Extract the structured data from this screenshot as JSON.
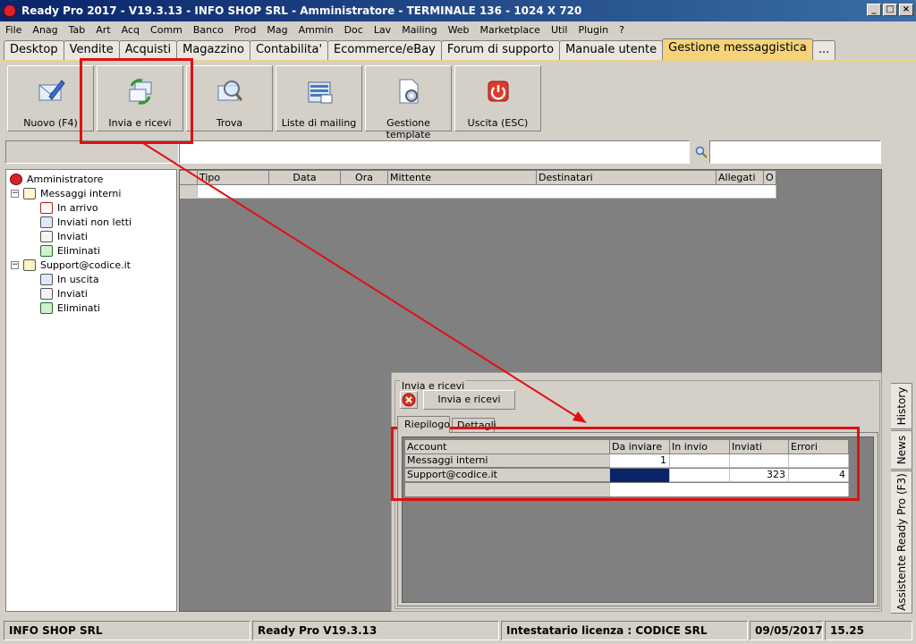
{
  "window": {
    "title": "Ready Pro 2017 - V19.3.13 - INFO SHOP SRL - Amministratore - TERMINALE 136 - 1024 X 720"
  },
  "menu": [
    "File",
    "Anag",
    "Tab",
    "Art",
    "Acq",
    "Comm",
    "Banco",
    "Prod",
    "Mag",
    "Ammin",
    "Doc",
    "Lav",
    "Mailing",
    "Web",
    "Marketplace",
    "Util",
    "Plugin",
    "?"
  ],
  "tabs": [
    {
      "label": "Desktop"
    },
    {
      "label": "Vendite"
    },
    {
      "label": "Acquisti"
    },
    {
      "label": "Magazzino"
    },
    {
      "label": "Contabilita'"
    },
    {
      "label": "Ecommerce/eBay"
    },
    {
      "label": "Forum di supporto"
    },
    {
      "label": "Manuale utente"
    },
    {
      "label": "Gestione messaggistica",
      "active": true
    },
    {
      "label": "..."
    }
  ],
  "toolbar": {
    "new": "Nuovo (F4)",
    "sendreceive": "Invia e ricevi",
    "find": "Trova",
    "lists": "Liste di mailing",
    "templates": "Gestione template",
    "exit": "Uscita (ESC)"
  },
  "tree": {
    "root": "Amministratore",
    "internal": "Messaggi interni",
    "inbox": "In arrivo",
    "unread_sent": "Inviati non letti",
    "sent": "Inviati",
    "deleted": "Eliminati",
    "account": "Support@codice.it",
    "outbox": "In uscita",
    "sent2": "Inviati",
    "deleted2": "Eliminati"
  },
  "grid": {
    "columns": [
      "Tipo",
      "Data",
      "Ora",
      "Mittente",
      "Destinatari",
      "Allegati",
      "O"
    ]
  },
  "dialog": {
    "group_title": "Invia e ricevi",
    "button": "Invia e ricevi",
    "tabs": [
      "Riepilogo",
      "Dettagli"
    ],
    "columns": [
      "Account",
      "Da inviare",
      "In invio",
      "Inviati",
      "Errori"
    ],
    "rows": [
      {
        "account": "Messaggi interni",
        "da_inviare": "1",
        "in_invio": "",
        "inviati": "",
        "errori": ""
      },
      {
        "account": "Support@codice.it",
        "da_inviare": "",
        "in_invio": "",
        "inviati": "323",
        "errori": "4"
      }
    ]
  },
  "side_tabs": {
    "history": "History",
    "news": "News",
    "assistant": "Assistente Ready Pro (F3)"
  },
  "status": {
    "company": "INFO SHOP SRL",
    "version": "Ready Pro V19.3.13",
    "license": "Intestatario licenza : CODICE SRL",
    "date": "09/05/2017",
    "time": "15.25"
  },
  "colors": {
    "title_bar": "#0a246a",
    "active_tab": "#f6d37b",
    "annotation": "#e01010",
    "selected_cell": "#0a246a"
  }
}
